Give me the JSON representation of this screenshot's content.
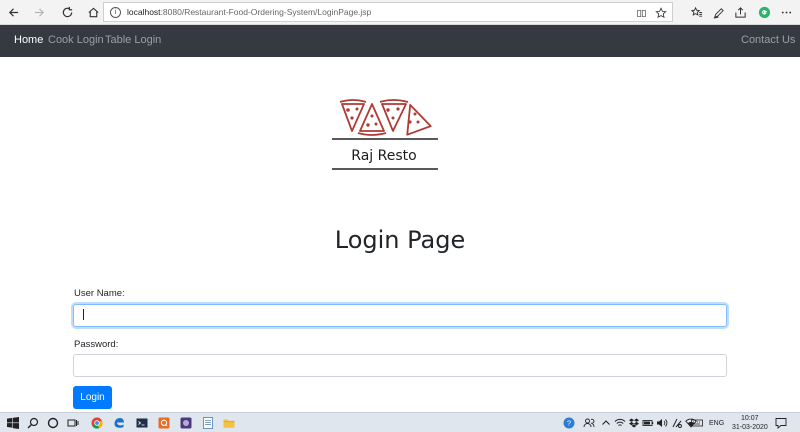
{
  "browser": {
    "url_host": "localhost",
    "url_rest": ":8080/Restaurant-Food-Ordering-System/LoginPage.jsp"
  },
  "navbar": {
    "links": [
      {
        "label": "Home"
      },
      {
        "label": "Cook Login"
      },
      {
        "label": "Table Login"
      }
    ],
    "contact": "Contact Us"
  },
  "logo": {
    "text": "Raj Resto"
  },
  "page": {
    "title": "Login Page"
  },
  "form": {
    "username_label": "User Name:",
    "username_value": "",
    "password_label": "Password:",
    "password_value": "",
    "submit_label": "Login"
  },
  "taskbar": {
    "language": "ENG",
    "time": "10:07",
    "date": "31-03-2020"
  },
  "colors": {
    "navbar_bg": "#343a40",
    "primary": "#007bff",
    "logo_red": "#b03a34"
  }
}
